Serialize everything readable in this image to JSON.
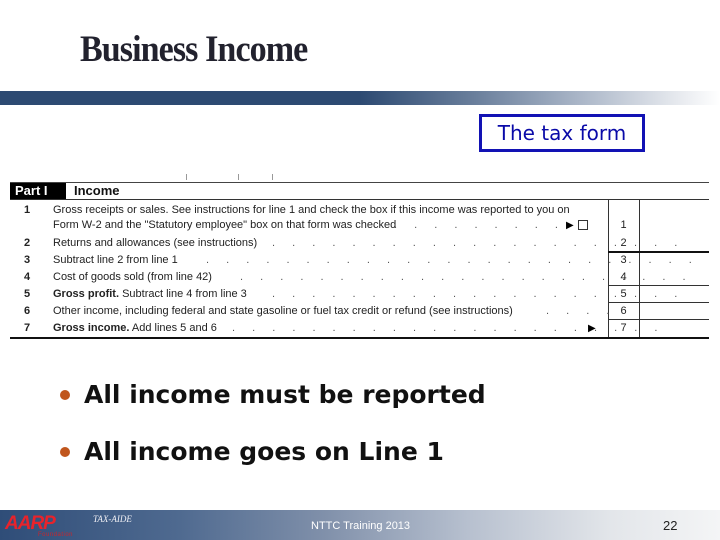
{
  "slide": {
    "title": "Business Income",
    "callout": "The tax form",
    "bullets": [
      "All income must be reported",
      "All income goes on Line 1"
    ],
    "colors": {
      "title_bar": "#2d4a72",
      "callout_border": "#1212b4",
      "bullet_dot": "#c0561d",
      "logo_red": "#e8232b"
    }
  },
  "form": {
    "part_label": "Part I",
    "part_title": "Income",
    "lines": [
      {
        "num": "1",
        "text_bold": "",
        "text": "Gross receipts or sales. See instructions for line 1 and check the box if this income was reported to you on",
        "text2": "Form W-2 and the \"Statutory employee\" box on that form was checked",
        "box": "1"
      },
      {
        "num": "2",
        "text_bold": "",
        "text": "Returns and allowances (see instructions)",
        "box": "2"
      },
      {
        "num": "3",
        "text_bold": "",
        "text": "Subtract line 2 from line 1",
        "box": "3"
      },
      {
        "num": "4",
        "text_bold": "",
        "text": "Cost of goods sold (from line 42)",
        "box": "4"
      },
      {
        "num": "5",
        "text_bold": "Gross profit.",
        "text": " Subtract line 4 from line 3",
        "box": "5"
      },
      {
        "num": "6",
        "text_bold": "",
        "text": "Other income, including federal and state gasoline or fuel tax credit or refund (see instructions)",
        "box": "6"
      },
      {
        "num": "7",
        "text_bold": "Gross income.",
        "text": " Add lines 5 and 6",
        "box": "7"
      }
    ],
    "dot_leader": ". . . . . . . . . . . . . . . . . . . . . . . . . . . . . .",
    "arrow": "▶"
  },
  "footer": {
    "logo": "AARP",
    "logo_sub": "Foundation",
    "program": "TAX-AIDE",
    "center_text": "NTTC Training 2013",
    "page_number": "22"
  }
}
